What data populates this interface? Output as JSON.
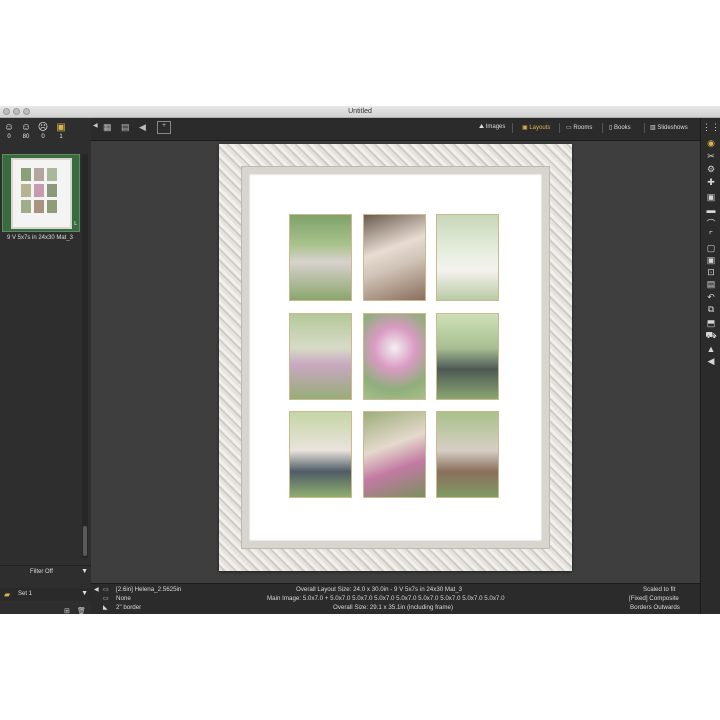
{
  "window": {
    "title": "Untitled"
  },
  "ratings": [
    {
      "icon": "smile-icon",
      "glyph": "☺",
      "count": "0"
    },
    {
      "icon": "neutral-face-icon",
      "glyph": "☺",
      "count": "80"
    },
    {
      "icon": "frown-icon",
      "glyph": "☹",
      "count": "0"
    },
    {
      "icon": "layout-icon",
      "glyph": "▣",
      "count": "1"
    }
  ],
  "thumbnail": {
    "caption": "9 V 5x7s in 24x30 Mat_3",
    "badge": "L"
  },
  "filter": {
    "label": "Filter Off"
  },
  "set": {
    "label": "Set 1"
  },
  "tabs": [
    {
      "label": "Images",
      "icon": "images-icon"
    },
    {
      "label": "Layouts",
      "icon": "layouts-icon"
    },
    {
      "label": "Rooms",
      "icon": "rooms-icon"
    },
    {
      "label": "Books",
      "icon": "books-icon"
    },
    {
      "label": "Slideshows",
      "icon": "slideshows-icon"
    }
  ],
  "active_tab": "Layouts",
  "status": {
    "left1": "[2.6in] Helena_2.5625in",
    "left2": "None",
    "left3": "2\" border",
    "center1": "Overall Layout Size: 24.0 x 30.0in - 9 V 5x7s in 24x30 Mat_3",
    "center2": "Main Image: 5.0x7.0 + 5.0x7.0  5.0x7.0  5.0x7.0  5.0x7.0  5.0x7.0  5.0x7.0  5.0x7.0  5.0x7.0",
    "center3": "Overall Size: 29.1 x 35.1in (including frame)",
    "right1": "Scaled to fit",
    "right2": "[Fixed] Composite",
    "right3": "Borders Outwards"
  },
  "colors": {
    "accent": "#e0b44a",
    "selection": "#3a6b3f",
    "frame": "#e6e3de"
  }
}
